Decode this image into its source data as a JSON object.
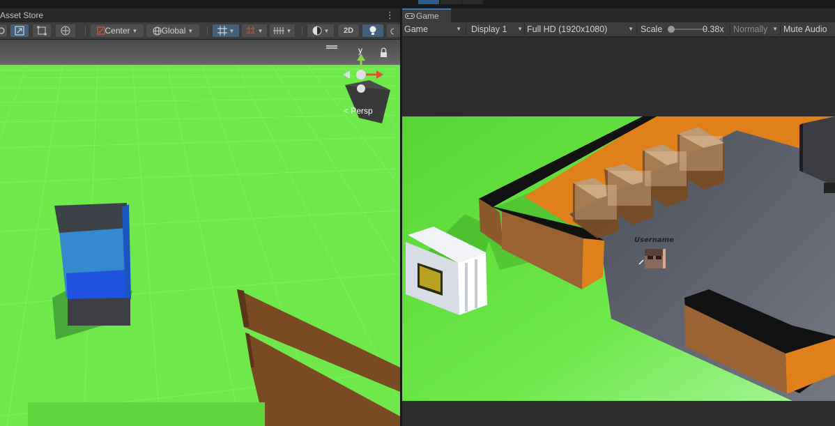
{
  "scene": {
    "tab_label": "Asset Store",
    "menu_icon": "kebab-menu-icon",
    "pivot_label": "Center",
    "space_label": "Global",
    "mode_2d_label": "2D",
    "gizmo": {
      "axis_label": "y",
      "projection_label": "Persp"
    }
  },
  "game": {
    "tab_label": "Game",
    "tab_icon": "gamepad-icon",
    "toolbar": {
      "view_type": "Game",
      "display": "Display 1",
      "resolution": "Full HD (1920x1080)",
      "scale_label": "Scale",
      "scale_value": "0.38x",
      "scale_fraction": 0.05,
      "focus_mode": "Normally",
      "mute_label": "Mute Audio"
    },
    "player_name": "Username"
  },
  "colors": {
    "editor_bg": "#383838",
    "tab_accent": "#3a79bb",
    "ground_green": "#6ee84a",
    "floor_orange": "#e0801a"
  }
}
